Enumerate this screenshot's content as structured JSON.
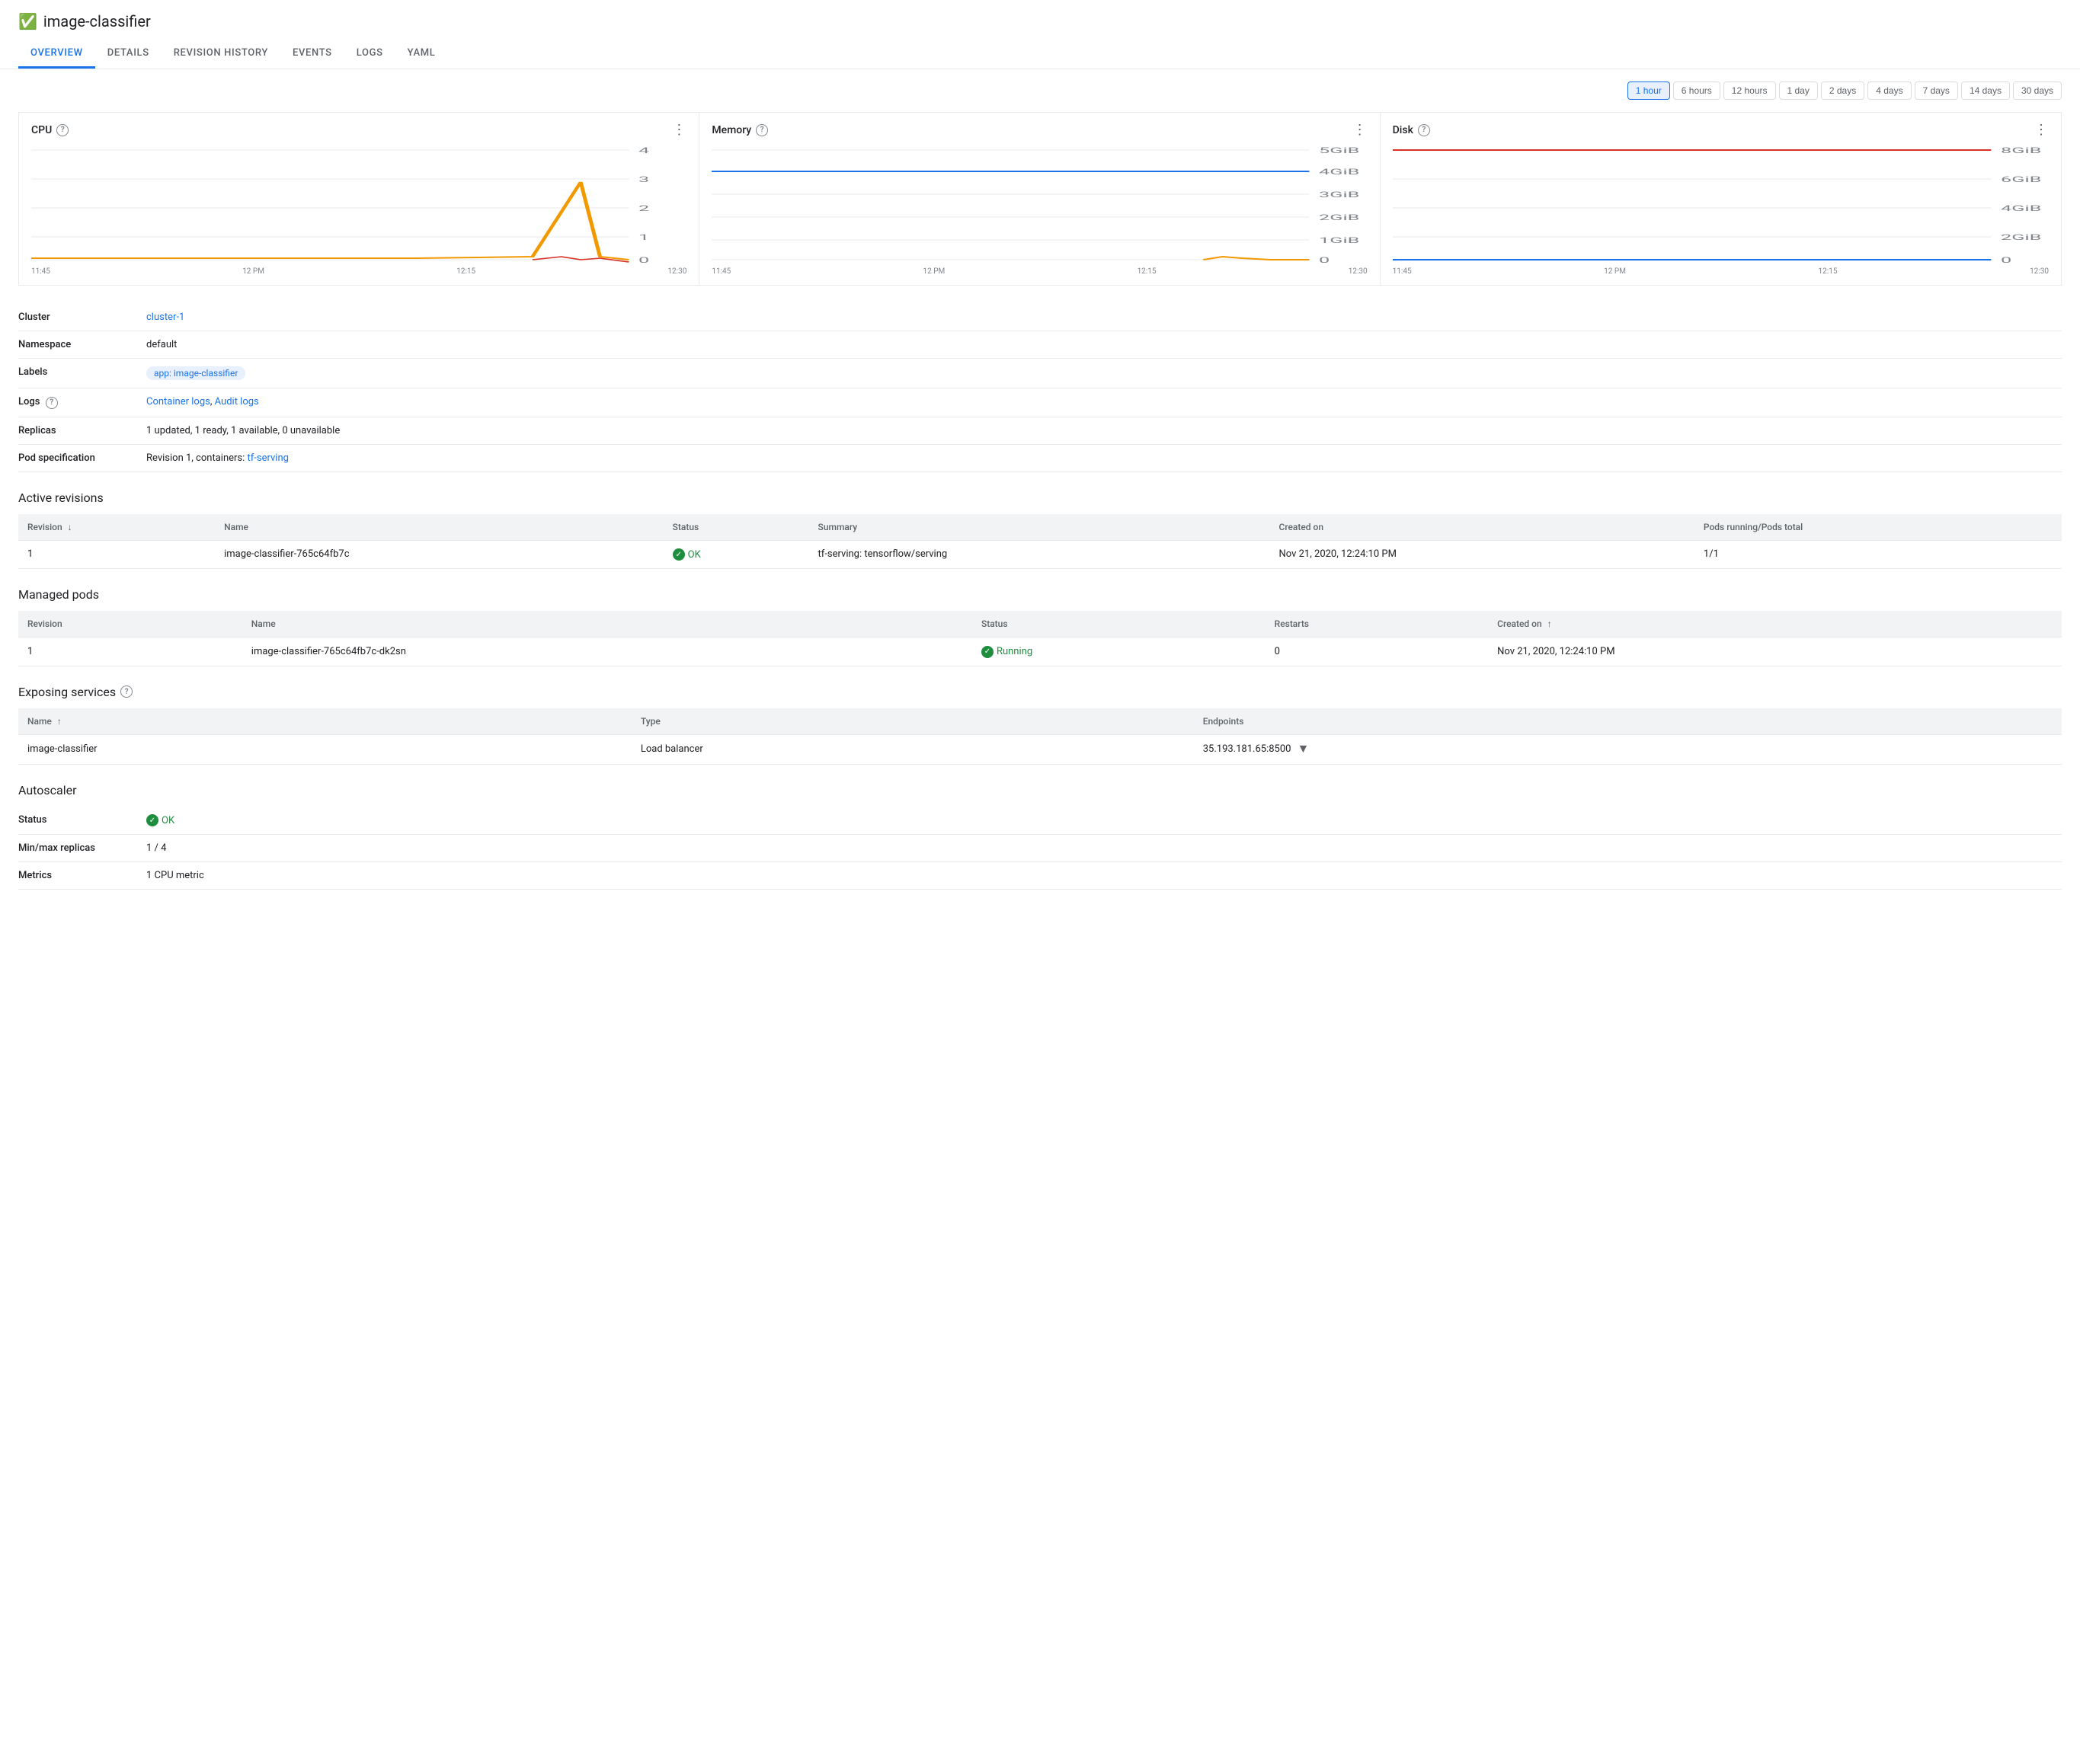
{
  "header": {
    "title": "image-classifier",
    "status_icon": "✓"
  },
  "nav": {
    "tabs": [
      {
        "id": "overview",
        "label": "OVERVIEW",
        "active": true
      },
      {
        "id": "details",
        "label": "DETAILS",
        "active": false
      },
      {
        "id": "revision-history",
        "label": "REVISION HISTORY",
        "active": false
      },
      {
        "id": "events",
        "label": "EVENTS",
        "active": false
      },
      {
        "id": "logs",
        "label": "LOGS",
        "active": false
      },
      {
        "id": "yaml",
        "label": "YAML",
        "active": false
      }
    ]
  },
  "time_range": {
    "options": [
      "1 hour",
      "6 hours",
      "12 hours",
      "1 day",
      "2 days",
      "4 days",
      "7 days",
      "14 days",
      "30 days"
    ],
    "active": "1 hour"
  },
  "charts": {
    "cpu": {
      "title": "CPU",
      "y_labels": [
        "4",
        "3",
        "2",
        "1",
        "0"
      ],
      "x_labels": [
        "11:45",
        "12 PM",
        "12:15",
        "12:30"
      ]
    },
    "memory": {
      "title": "Memory",
      "y_labels": [
        "5GiB",
        "4GiB",
        "3GiB",
        "2GiB",
        "1GiB",
        "0"
      ],
      "x_labels": [
        "11:45",
        "12 PM",
        "12:15",
        "12:30"
      ]
    },
    "disk": {
      "title": "Disk",
      "y_labels": [
        "8GiB",
        "6GiB",
        "4GiB",
        "2GiB",
        "0"
      ],
      "x_labels": [
        "11:45",
        "12 PM",
        "12:15",
        "12:30"
      ]
    }
  },
  "info": {
    "cluster_label": "Cluster",
    "cluster_value": "cluster-1",
    "namespace_label": "Namespace",
    "namespace_value": "default",
    "labels_label": "Labels",
    "labels_chip": "app: image-classifier",
    "logs_label": "Logs",
    "logs_help": true,
    "logs_link1": "Container logs",
    "logs_link2": "Audit logs",
    "replicas_label": "Replicas",
    "replicas_value": "1 updated, 1 ready, 1 available, 0 unavailable",
    "pod_spec_label": "Pod specification",
    "pod_spec_prefix": "Revision 1, containers: ",
    "pod_spec_link": "tf-serving"
  },
  "active_revisions": {
    "title": "Active revisions",
    "columns": [
      "Revision",
      "Name",
      "Status",
      "Summary",
      "Created on",
      "Pods running/Pods total"
    ],
    "rows": [
      {
        "revision": "1",
        "name": "image-classifier-765c64fb7c",
        "status": "OK",
        "summary": "tf-serving: tensorflow/serving",
        "created_on": "Nov 21, 2020, 12:24:10 PM",
        "pods": "1/1"
      }
    ]
  },
  "managed_pods": {
    "title": "Managed pods",
    "columns": [
      "Revision",
      "Name",
      "Status",
      "Restarts",
      "Created on"
    ],
    "rows": [
      {
        "revision": "1",
        "name": "image-classifier-765c64fb7c-dk2sn",
        "status": "Running",
        "restarts": "0",
        "created_on": "Nov 21, 2020, 12:24:10 PM"
      }
    ]
  },
  "exposing_services": {
    "title": "Exposing services",
    "columns": [
      "Name",
      "Type",
      "Endpoints"
    ],
    "rows": [
      {
        "name": "image-classifier",
        "type": "Load balancer",
        "endpoint": "35.193.181.65:8500"
      }
    ]
  },
  "autoscaler": {
    "title": "Autoscaler",
    "status_label": "Status",
    "status_value": "OK",
    "replicas_label": "Min/max replicas",
    "replicas_value": "1 / 4",
    "metrics_label": "Metrics",
    "metrics_value": "1 CPU metric"
  }
}
